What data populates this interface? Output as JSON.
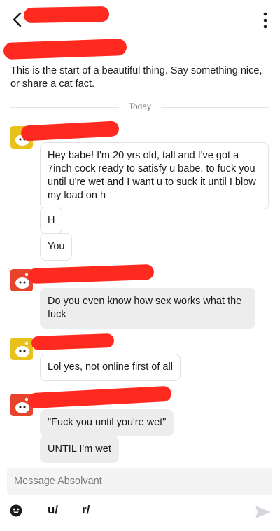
{
  "intro": {
    "text": "This is the start of a beautiful thing. Say something nice, or share a cat fact."
  },
  "divider": {
    "label": "Today"
  },
  "messages": [
    "Hey babe! I'm 20 yrs old, tall and I've got a 7inch cock ready to satisfy u babe, to fuck you until u're wet and I want u to suck it until I blow my load on h",
    "H",
    "You",
    "Do you even know how sex works what the fuck",
    "Lol yes, not online first of all",
    "\"Fuck you until you're wet\"",
    "UNTIL I'm wet"
  ],
  "composer": {
    "placeholder": "Message Absolvant",
    "user_tool": "u/",
    "subreddit_tool": "r/"
  },
  "icons": {
    "back": "back-arrow-icon",
    "menu": "more-vertical-icon",
    "avatar": "snoo-avatar-icon",
    "emoji": "emoji-icon",
    "send": "send-icon"
  },
  "colors": {
    "redaction": "#ff2a1f",
    "avatar_yellow": "#e8c21a",
    "avatar_red": "#e8432c",
    "bubble_grey": "#ededed"
  }
}
